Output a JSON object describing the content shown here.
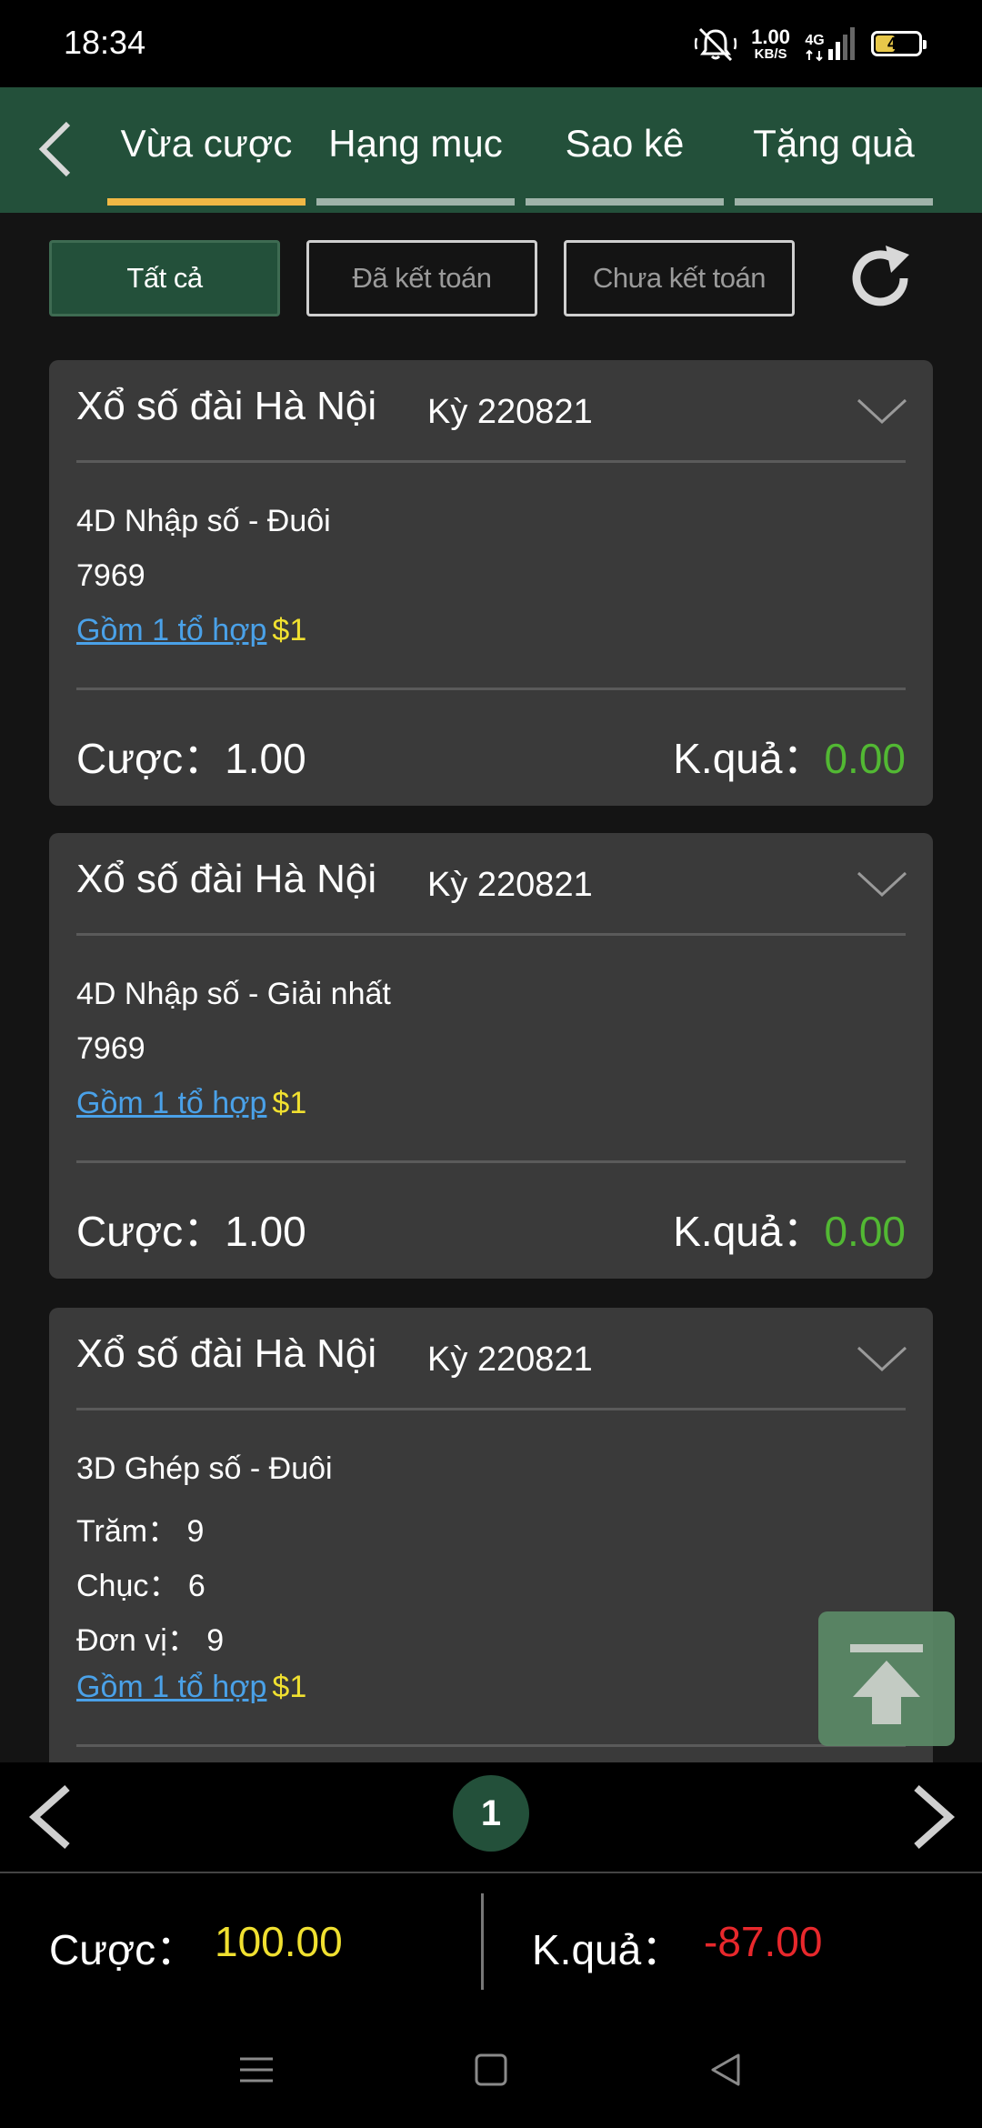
{
  "status": {
    "time": "18:34",
    "speed_value": "1.00",
    "speed_unit": "KB/S",
    "network": "4G",
    "battery": "42",
    "battery_fraction": 0.42
  },
  "tabs": [
    {
      "label": "Vừa cược",
      "active": true
    },
    {
      "label": "Hạng mục",
      "active": false
    },
    {
      "label": "Sao kê",
      "active": false
    },
    {
      "label": "Tặng quà",
      "active": false
    }
  ],
  "filters": [
    {
      "label": "Tất cả",
      "active": true
    },
    {
      "label": "Đã kết toán",
      "active": false
    },
    {
      "label": "Chưa kết toán",
      "active": false
    }
  ],
  "cards": [
    {
      "title": "Xổ số đài Hà Nội",
      "period": "Kỳ 220821",
      "bet_type": "4D Nhập số - Đuôi",
      "number": "7969",
      "combo_text": "Gồm 1 tổ hợp",
      "combo_amount": "$1",
      "bet_label": "Cược：",
      "bet_value": "1.00",
      "result_label": "K.quả：",
      "result_value": "0.00"
    },
    {
      "title": "Xổ số đài Hà Nội",
      "period": "Kỳ 220821",
      "bet_type": "4D Nhập số - Giải nhất",
      "number": "7969",
      "combo_text": "Gồm 1 tổ hợp",
      "combo_amount": "$1",
      "bet_label": "Cược：",
      "bet_value": "1.00",
      "result_label": "K.quả：",
      "result_value": "0.00"
    },
    {
      "title": "Xổ số đài Hà Nội",
      "period": "Kỳ 220821",
      "bet_type": "3D Ghép số - Đuôi",
      "digits": [
        {
          "label": "Trăm：",
          "value": "9"
        },
        {
          "label": "Chục：",
          "value": "6"
        },
        {
          "label": "Đơn vị：",
          "value": "9"
        }
      ],
      "combo_text": "Gồm 1 tổ hợp",
      "combo_amount": "$1"
    }
  ],
  "pager": {
    "current": "1"
  },
  "totals": {
    "bet_label": "Cược：",
    "bet_value": "100.00",
    "result_label": "K.quả：",
    "result_value": "-87.00"
  },
  "colors": {
    "header": "#23503a",
    "active_tab": "#f0b845",
    "link": "#4aa1e8",
    "amount": "#f0e030",
    "win": "#52b833",
    "loss": "#e8282c"
  }
}
